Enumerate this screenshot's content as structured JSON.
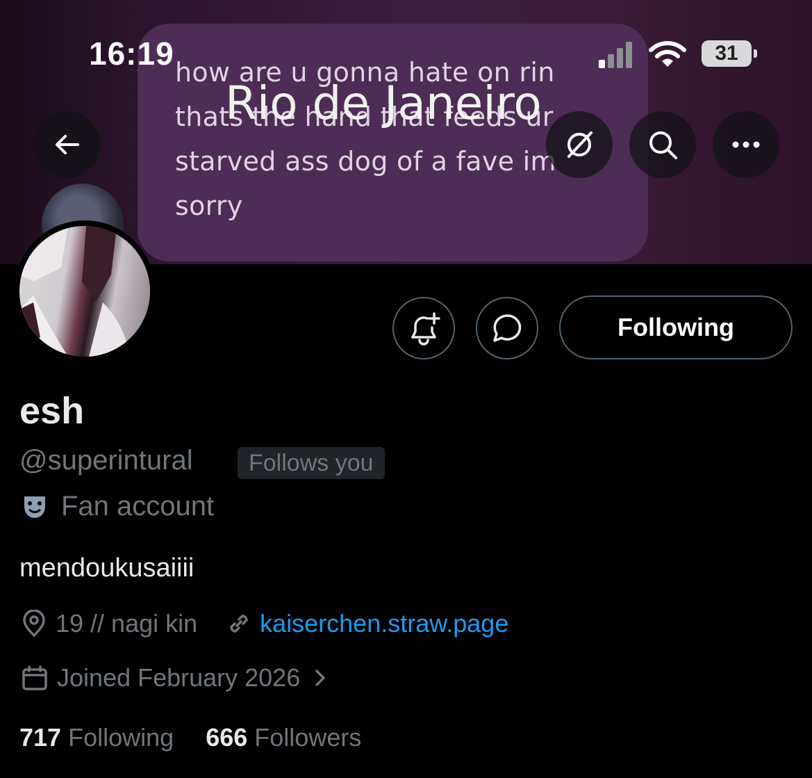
{
  "status_bar": {
    "time": "16:19",
    "battery": "31"
  },
  "banner": {
    "bubble_text": "how are u gonna hate on rin\nthats the hand that feeds ur\nstarved ass dog of a fave im\nsorry"
  },
  "header": {
    "location_title": "Rio de Janeiro",
    "icons": [
      "back-arrow-icon",
      "grok-icon",
      "search-icon",
      "more-icon"
    ]
  },
  "actions": {
    "notify_icon": "bell-plus-icon",
    "message_icon": "message-icon",
    "following_label": "Following"
  },
  "profile": {
    "display_name": "esh",
    "handle": "@superintural",
    "follows_you": "Follows you",
    "category": "Fan account",
    "bio": "mendoukusaiiii",
    "location": "19 // nagi kin",
    "website": "kaiserchen.straw.page",
    "joined": "Joined February 2026",
    "following_count": "717",
    "following_label": "Following",
    "followers_count": "666",
    "followers_label": "Followers"
  },
  "colors": {
    "link": "#1d9bf0",
    "muted": "#71767b",
    "text": "#e7e9ea",
    "border": "#536471"
  }
}
